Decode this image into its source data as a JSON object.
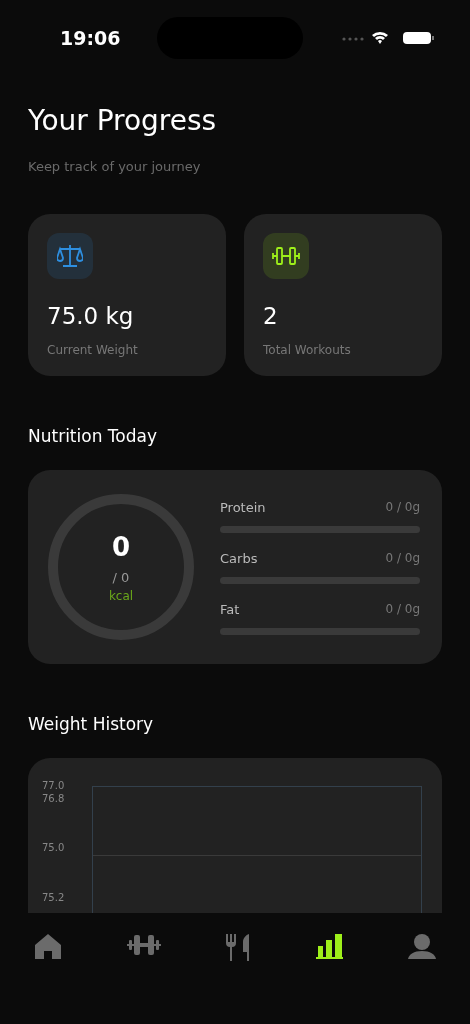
{
  "status_bar": {
    "time": "19:06"
  },
  "header": {
    "title": "Your Progress",
    "subtitle": "Keep track of your journey"
  },
  "stats": [
    {
      "kind": "weight",
      "value": "75.0 kg",
      "label": "Current Weight",
      "color": "#2e8fe0"
    },
    {
      "kind": "workouts",
      "value": "2",
      "label": "Total Workouts",
      "color": "#9ef01a"
    }
  ],
  "nutrition": {
    "title": "Nutrition Today",
    "calories": {
      "value": "0",
      "goal": "/ 0",
      "unit": "kcal"
    },
    "macros": [
      {
        "name": "Protein",
        "reading": "0 / 0g",
        "level": 0
      },
      {
        "name": "Carbs",
        "reading": "0 / 0g",
        "level": 0
      },
      {
        "name": "Fat",
        "reading": "0 / 0g",
        "level": 0
      }
    ]
  },
  "weight_history": {
    "title": "Weight History",
    "y_labels": [
      "77.0",
      "76.8",
      "75.0",
      "75.2"
    ]
  },
  "tab_bar": [
    {
      "kind": "home",
      "selected": false
    },
    {
      "kind": "workouts",
      "selected": false
    },
    {
      "kind": "meals",
      "selected": false
    },
    {
      "kind": "progress",
      "selected": true
    },
    {
      "kind": "profile",
      "selected": false
    }
  ]
}
